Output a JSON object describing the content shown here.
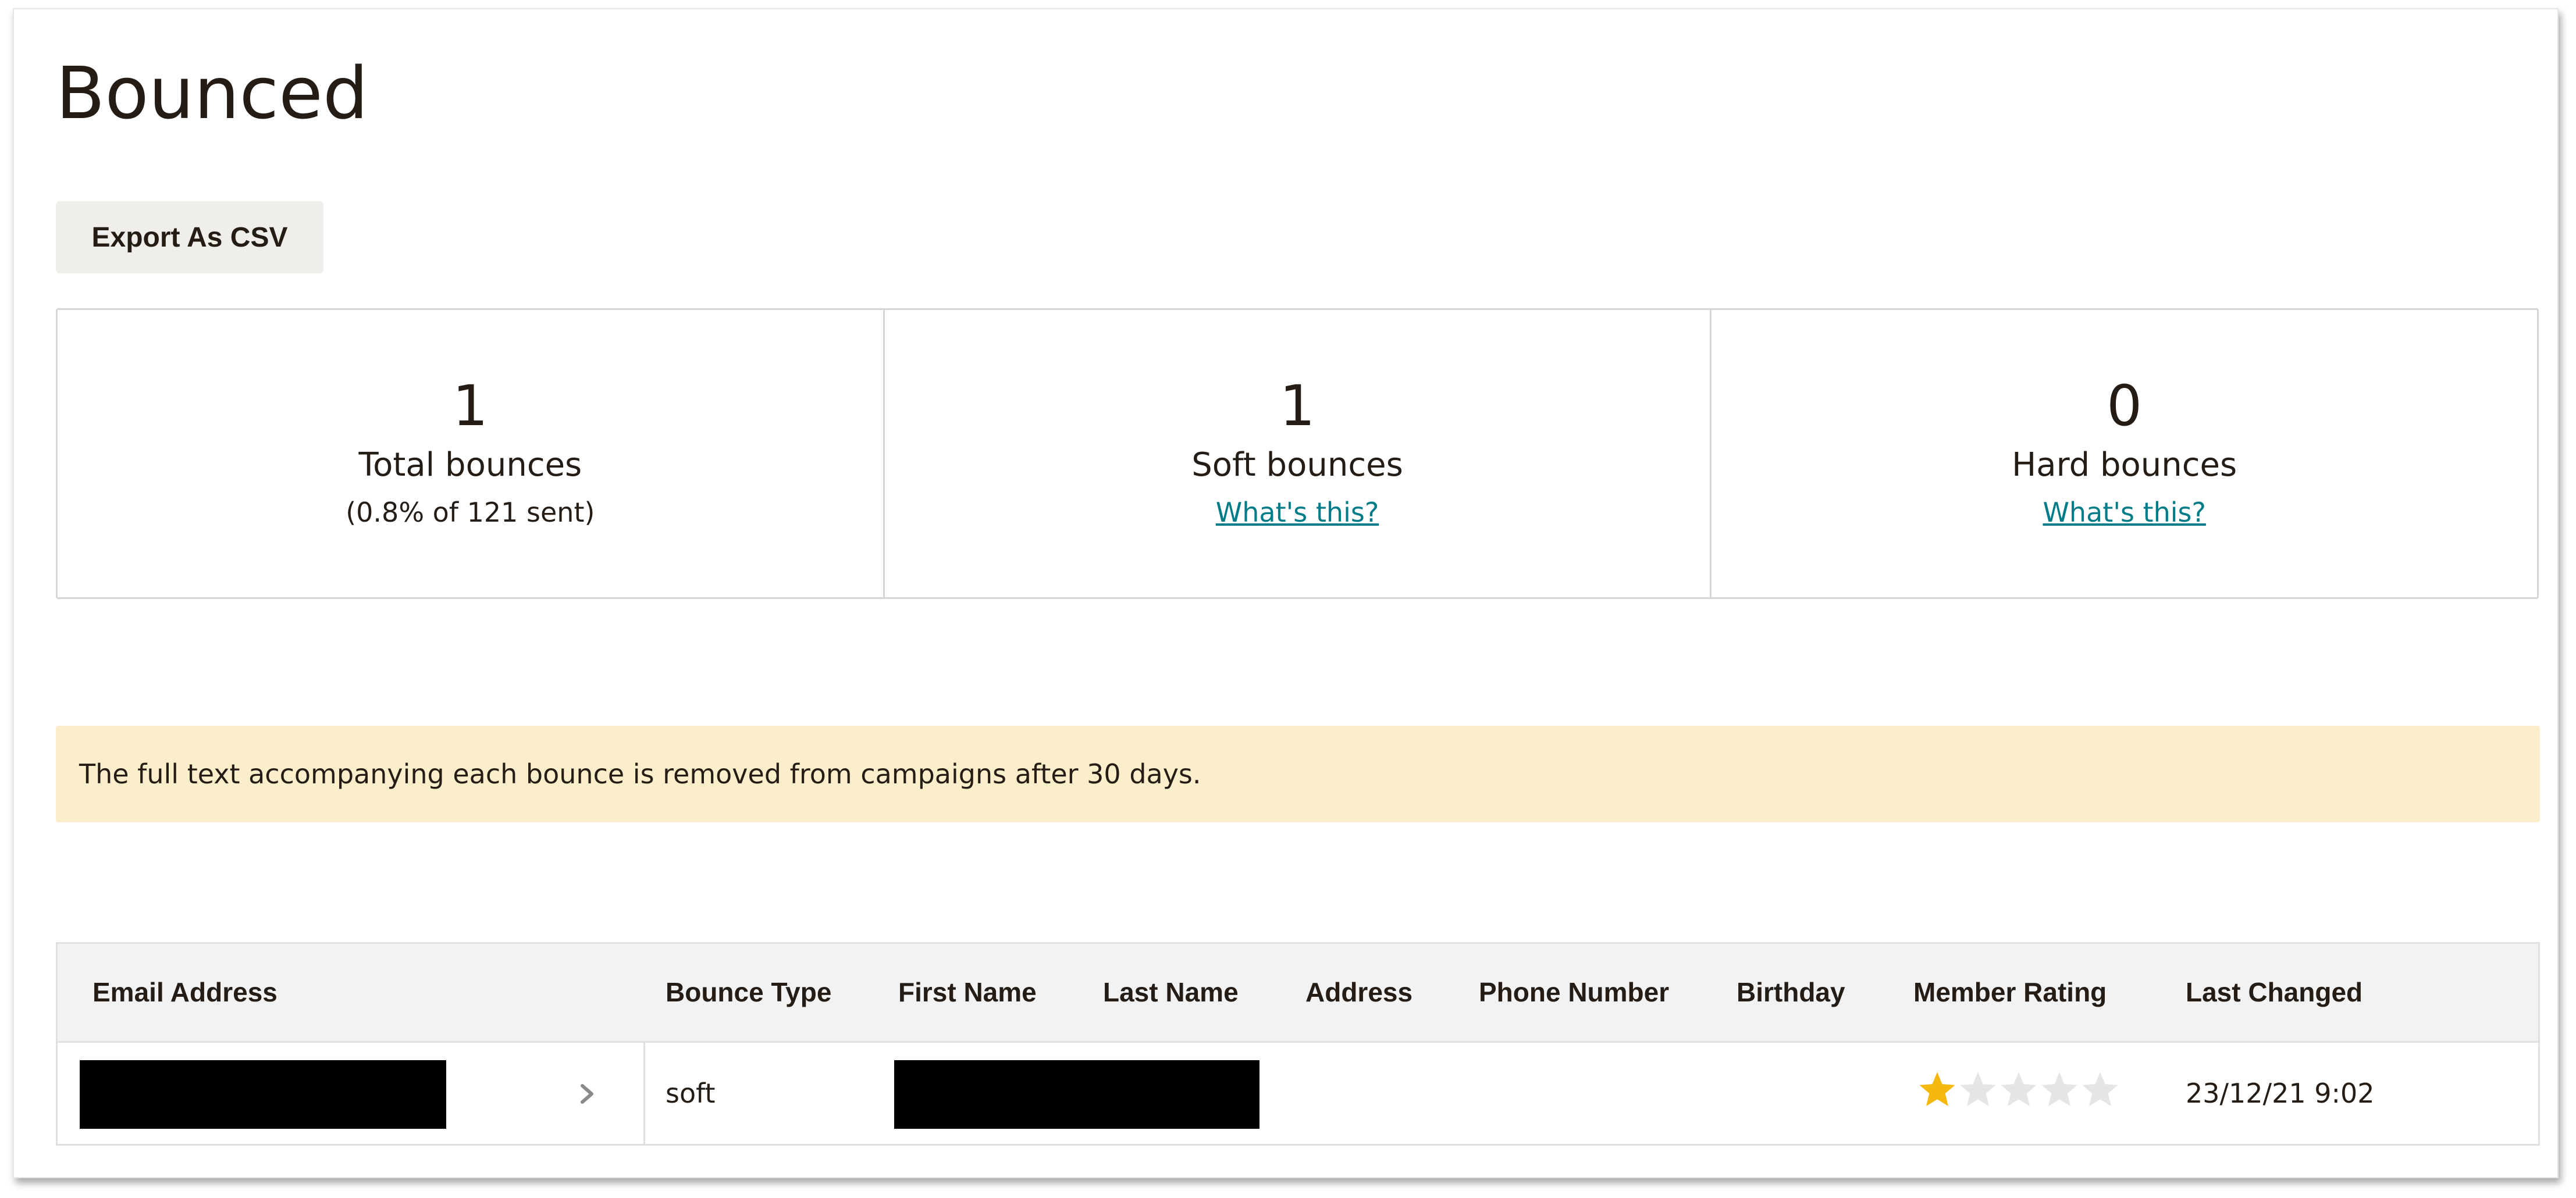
{
  "page": {
    "title": "Bounced",
    "export_label": "Export As CSV"
  },
  "stats": {
    "total": {
      "value": "1",
      "label": "Total bounces",
      "sub": "(0.8% of 121 sent)"
    },
    "soft": {
      "value": "1",
      "label": "Soft bounces",
      "link": "What's this?"
    },
    "hard": {
      "value": "0",
      "label": "Hard bounces",
      "link": "What's this?"
    }
  },
  "notice": {
    "text": "The full text accompanying each bounce is removed from campaigns after 30 days.",
    "background": "#fbeecb"
  },
  "table": {
    "headers": {
      "email": "Email Address",
      "bounce_type": "Bounce Type",
      "first_name": "First Name",
      "last_name": "Last Name",
      "address": "Address",
      "phone": "Phone Number",
      "birthday": "Birthday",
      "rating": "Member Rating",
      "last_changed": "Last Changed"
    },
    "rows": [
      {
        "email": "[redacted]",
        "bounce_type": "soft",
        "first_name": "[redacted]",
        "last_name": "[redacted]",
        "address": "",
        "phone": "",
        "birthday": "",
        "member_rating": 1,
        "member_rating_max": 5,
        "last_changed": "23/12/21 9:02"
      }
    ]
  },
  "colors": {
    "link": "#007c89",
    "star_filled": "#f5b80e",
    "star_empty": "#e5e5e5",
    "button_bg": "#efeeea"
  },
  "icons": {
    "row_expand": "chevron-right-icon",
    "rating": "star-icon"
  }
}
